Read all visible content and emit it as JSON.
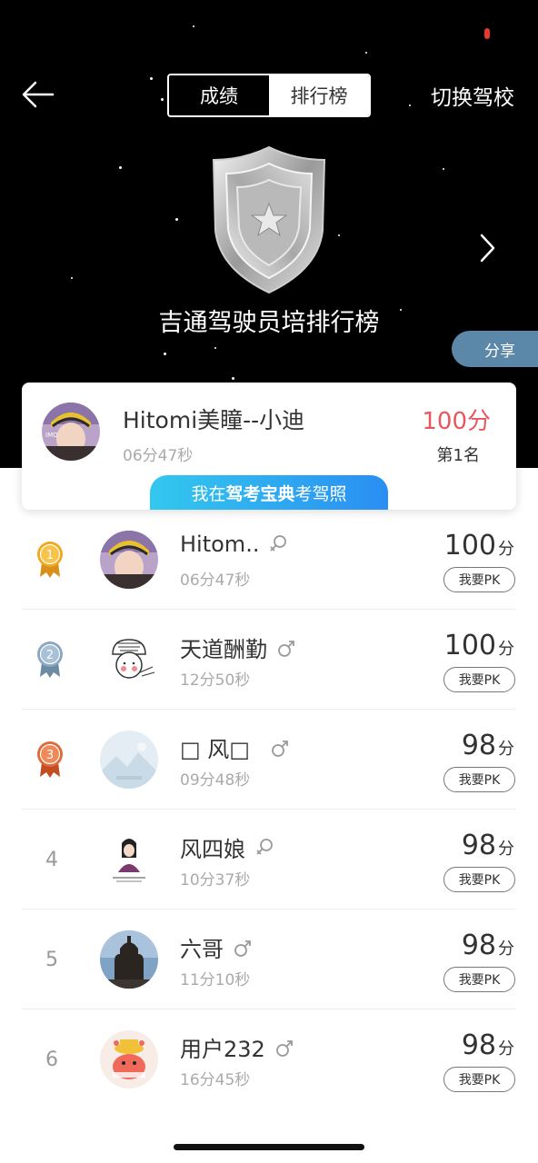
{
  "header": {
    "tabs": [
      {
        "label": "成绩",
        "active": false
      },
      {
        "label": "排行榜",
        "active": true
      }
    ],
    "switch_school": "切换驾校",
    "back_icon": "arrow-left-icon",
    "next_icon": "chevron-right-icon"
  },
  "board": {
    "title": "吉通驾驶员培排行榜",
    "share_label": "分享",
    "badge_icon": "shield-star-icon"
  },
  "me": {
    "name": "Hitomi美瞳--小迪",
    "time": "06分47秒",
    "score": "100分",
    "rank": "第1名",
    "banner_prefix": "我在",
    "banner_brand": "驾考宝典",
    "banner_suffix": "考驾照"
  },
  "ranking": {
    "pk_label": "我要PK",
    "score_unit": "分",
    "rows": [
      {
        "rank": "1",
        "medal": "gold",
        "name": "Hitom..",
        "gender": "female",
        "time": "06分47秒",
        "score": "100"
      },
      {
        "rank": "2",
        "medal": "silver",
        "name": "天道酬勤",
        "gender": "male",
        "time": "12分50秒",
        "score": "100"
      },
      {
        "rank": "3",
        "medal": "bronze",
        "name": "□ 风□",
        "gender": "male",
        "time": "09分48秒",
        "score": "98"
      },
      {
        "rank": "4",
        "medal": "",
        "name": "风四娘",
        "gender": "female",
        "time": "10分37秒",
        "score": "98"
      },
      {
        "rank": "5",
        "medal": "",
        "name": "六哥",
        "gender": "male",
        "time": "11分10秒",
        "score": "98"
      },
      {
        "rank": "6",
        "medal": "",
        "name": "用户232",
        "gender": "male",
        "time": "16分45秒",
        "score": "98"
      }
    ]
  },
  "colors": {
    "score_highlight": "#e8575e",
    "share_bg": "#5b88a9",
    "gold": "#f0a91e",
    "silver": "#8aa8c2",
    "bronze": "#e06a3a",
    "banner_start": "#33c8ee",
    "banner_end": "#2a8ef3"
  }
}
